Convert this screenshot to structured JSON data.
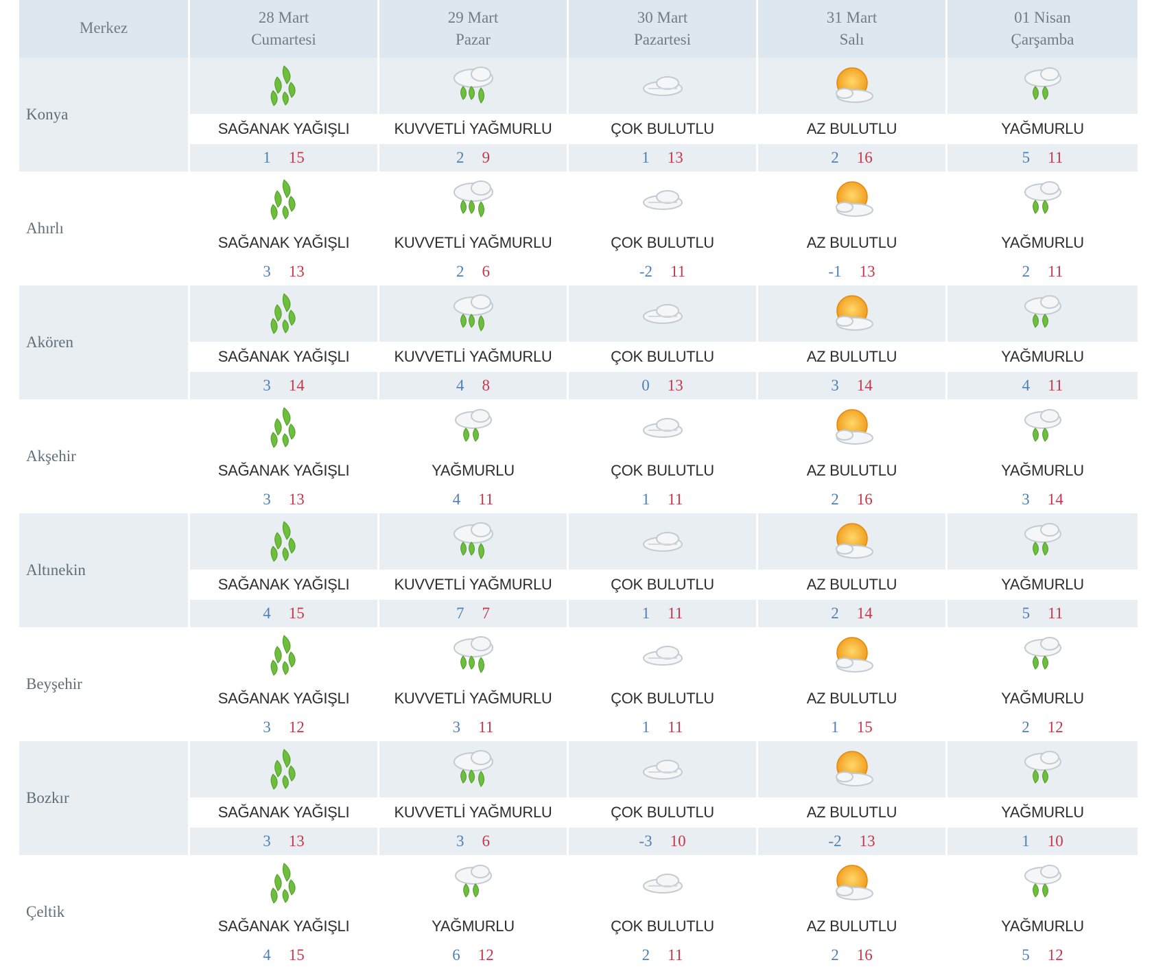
{
  "header": {
    "corner_label": "Merkez",
    "days": [
      {
        "date": "28 Mart",
        "weekday": "Cumartesi"
      },
      {
        "date": "29 Mart",
        "weekday": "Pazar"
      },
      {
        "date": "30 Mart",
        "weekday": "Pazartesi"
      },
      {
        "date": "31 Mart",
        "weekday": "Salı"
      },
      {
        "date": "01 Nisan",
        "weekday": "Çarşamba"
      }
    ]
  },
  "colors": {
    "header_bg": "#dce7ef",
    "row_shade": "#e9eef2",
    "min_temp": "#4f7fb5",
    "max_temp": "#c0394a",
    "rain_green": "#6dbe3c",
    "sun_orange": "#f5a623"
  },
  "rows": [
    {
      "city": "Konya",
      "days": [
        {
          "icon": "heavy-rain-icon",
          "desc": "SAĞANAK YAĞIŞLI",
          "min": "1",
          "max": "15"
        },
        {
          "icon": "cloud-strong-rain-icon",
          "desc": "KUVVETLİ YAĞMURLU",
          "min": "2",
          "max": "9"
        },
        {
          "icon": "overcast-cloud-icon",
          "desc": "ÇOK BULUTLU",
          "min": "1",
          "max": "13"
        },
        {
          "icon": "sun-cloud-icon",
          "desc": "AZ BULUTLU",
          "min": "2",
          "max": "16"
        },
        {
          "icon": "cloud-rain-icon",
          "desc": "YAĞMURLU",
          "min": "5",
          "max": "11"
        }
      ]
    },
    {
      "city": "Ahırlı",
      "days": [
        {
          "icon": "heavy-rain-icon",
          "desc": "SAĞANAK YAĞIŞLI",
          "min": "3",
          "max": "13"
        },
        {
          "icon": "cloud-strong-rain-icon",
          "desc": "KUVVETLİ YAĞMURLU",
          "min": "2",
          "max": "6"
        },
        {
          "icon": "overcast-cloud-icon",
          "desc": "ÇOK BULUTLU",
          "min": "-2",
          "max": "11"
        },
        {
          "icon": "sun-cloud-icon",
          "desc": "AZ BULUTLU",
          "min": "-1",
          "max": "13"
        },
        {
          "icon": "cloud-rain-icon",
          "desc": "YAĞMURLU",
          "min": "2",
          "max": "11"
        }
      ]
    },
    {
      "city": "Akören",
      "days": [
        {
          "icon": "heavy-rain-icon",
          "desc": "SAĞANAK YAĞIŞLI",
          "min": "3",
          "max": "14"
        },
        {
          "icon": "cloud-strong-rain-icon",
          "desc": "KUVVETLİ YAĞMURLU",
          "min": "4",
          "max": "8"
        },
        {
          "icon": "overcast-cloud-icon",
          "desc": "ÇOK BULUTLU",
          "min": "0",
          "max": "13"
        },
        {
          "icon": "sun-cloud-icon",
          "desc": "AZ BULUTLU",
          "min": "3",
          "max": "14"
        },
        {
          "icon": "cloud-rain-icon",
          "desc": "YAĞMURLU",
          "min": "4",
          "max": "11"
        }
      ]
    },
    {
      "city": "Akşehir",
      "days": [
        {
          "icon": "heavy-rain-icon",
          "desc": "SAĞANAK YAĞIŞLI",
          "min": "3",
          "max": "13"
        },
        {
          "icon": "cloud-rain-icon",
          "desc": "YAĞMURLU",
          "min": "4",
          "max": "11"
        },
        {
          "icon": "overcast-cloud-icon",
          "desc": "ÇOK BULUTLU",
          "min": "1",
          "max": "11"
        },
        {
          "icon": "sun-cloud-icon",
          "desc": "AZ BULUTLU",
          "min": "2",
          "max": "16"
        },
        {
          "icon": "cloud-rain-icon",
          "desc": "YAĞMURLU",
          "min": "3",
          "max": "14"
        }
      ]
    },
    {
      "city": "Altınekin",
      "days": [
        {
          "icon": "heavy-rain-icon",
          "desc": "SAĞANAK YAĞIŞLI",
          "min": "4",
          "max": "15"
        },
        {
          "icon": "cloud-strong-rain-icon",
          "desc": "KUVVETLİ YAĞMURLU",
          "min": "7",
          "max": "7"
        },
        {
          "icon": "overcast-cloud-icon",
          "desc": "ÇOK BULUTLU",
          "min": "1",
          "max": "11"
        },
        {
          "icon": "sun-cloud-icon",
          "desc": "AZ BULUTLU",
          "min": "2",
          "max": "14"
        },
        {
          "icon": "cloud-rain-icon",
          "desc": "YAĞMURLU",
          "min": "5",
          "max": "11"
        }
      ]
    },
    {
      "city": "Beyşehir",
      "days": [
        {
          "icon": "heavy-rain-icon",
          "desc": "SAĞANAK YAĞIŞLI",
          "min": "3",
          "max": "12"
        },
        {
          "icon": "cloud-strong-rain-icon",
          "desc": "KUVVETLİ YAĞMURLU",
          "min": "3",
          "max": "11"
        },
        {
          "icon": "overcast-cloud-icon",
          "desc": "ÇOK BULUTLU",
          "min": "1",
          "max": "11"
        },
        {
          "icon": "sun-cloud-icon",
          "desc": "AZ BULUTLU",
          "min": "1",
          "max": "15"
        },
        {
          "icon": "cloud-rain-icon",
          "desc": "YAĞMURLU",
          "min": "2",
          "max": "12"
        }
      ]
    },
    {
      "city": "Bozkır",
      "days": [
        {
          "icon": "heavy-rain-icon",
          "desc": "SAĞANAK YAĞIŞLI",
          "min": "3",
          "max": "13"
        },
        {
          "icon": "cloud-strong-rain-icon",
          "desc": "KUVVETLİ YAĞMURLU",
          "min": "3",
          "max": "6"
        },
        {
          "icon": "overcast-cloud-icon",
          "desc": "ÇOK BULUTLU",
          "min": "-3",
          "max": "10"
        },
        {
          "icon": "sun-cloud-icon",
          "desc": "AZ BULUTLU",
          "min": "-2",
          "max": "13"
        },
        {
          "icon": "cloud-rain-icon",
          "desc": "YAĞMURLU",
          "min": "1",
          "max": "10"
        }
      ]
    },
    {
      "city": "Çeltik",
      "days": [
        {
          "icon": "heavy-rain-icon",
          "desc": "SAĞANAK YAĞIŞLI",
          "min": "4",
          "max": "15"
        },
        {
          "icon": "cloud-rain-icon",
          "desc": "YAĞMURLU",
          "min": "6",
          "max": "12"
        },
        {
          "icon": "overcast-cloud-icon",
          "desc": "ÇOK BULUTLU",
          "min": "2",
          "max": "11"
        },
        {
          "icon": "sun-cloud-icon",
          "desc": "AZ BULUTLU",
          "min": "2",
          "max": "16"
        },
        {
          "icon": "cloud-rain-icon",
          "desc": "YAĞMURLU",
          "min": "5",
          "max": "12"
        }
      ]
    }
  ]
}
